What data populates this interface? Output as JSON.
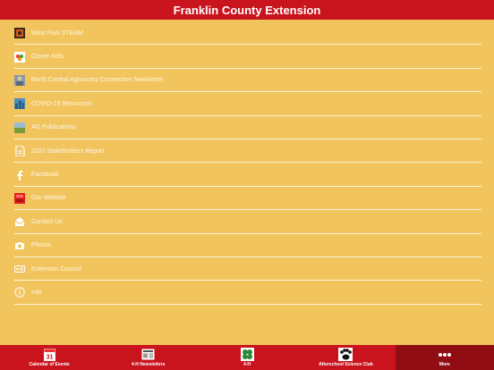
{
  "header": {
    "title": "Franklin County Extension"
  },
  "list": [
    {
      "label": "West Fork STEAM",
      "icon": "steam-photo-icon"
    },
    {
      "label": "Clover Kids",
      "icon": "clover-kids-icon"
    },
    {
      "label": "North Central Agronomy Connection Newsletter",
      "icon": "newsletter-photo-icon"
    },
    {
      "label": "COVID-19 Resources",
      "icon": "covid-resources-icon"
    },
    {
      "label": "AG Publications",
      "icon": "ag-field-icon"
    },
    {
      "label": "2020 Stakeholders Report",
      "icon": "document-icon"
    },
    {
      "label": "Facebook",
      "icon": "facebook-icon"
    },
    {
      "label": "Our Website",
      "icon": "website-icon"
    },
    {
      "label": "Contact Us",
      "icon": "envelope-icon"
    },
    {
      "label": "Photos",
      "icon": "camera-icon"
    },
    {
      "label": "Extension Council",
      "icon": "id-card-icon"
    },
    {
      "label": "Info",
      "icon": "info-icon"
    }
  ],
  "tabs": [
    {
      "label": "Calendar of Events",
      "icon": "calendar-icon",
      "day": "31"
    },
    {
      "label": "4-H Newsletters",
      "icon": "newsletter-icon"
    },
    {
      "label": "4-H",
      "icon": "clover-icon"
    },
    {
      "label": "Afterschool Science Club",
      "icon": "paw-icon"
    },
    {
      "label": "More",
      "icon": "more-dots-icon",
      "selected": true
    }
  ],
  "colors": {
    "header": "#c9141d",
    "background": "#f1c45e",
    "selected_tab": "#8f0d13"
  }
}
